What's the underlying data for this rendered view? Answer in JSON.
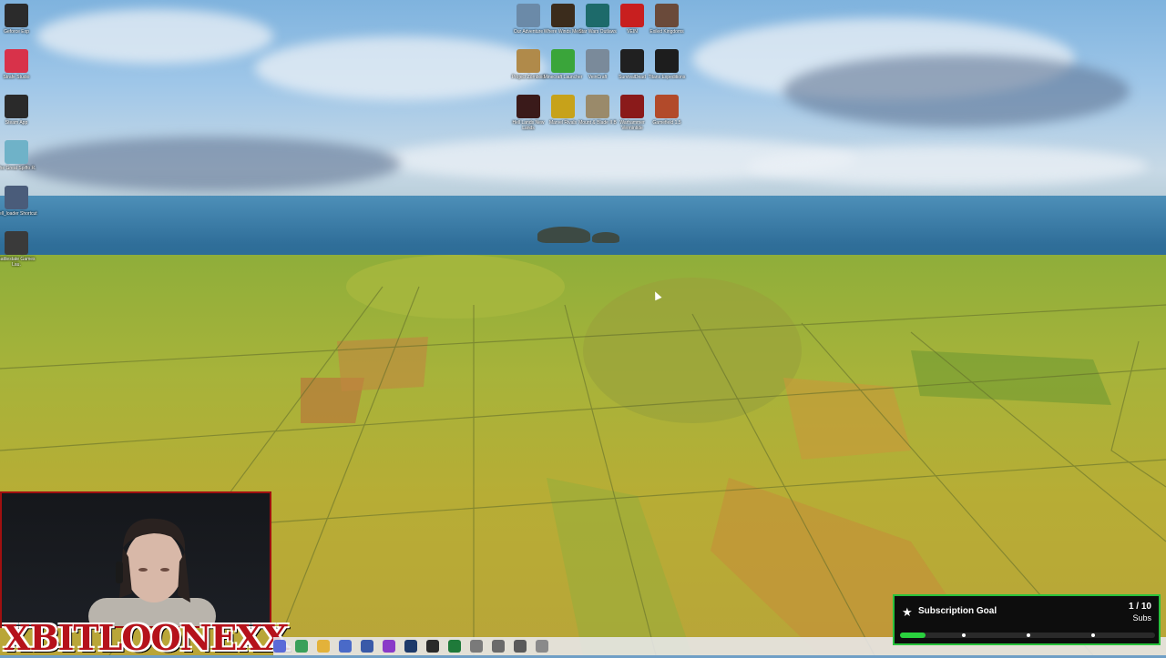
{
  "desktop_left": [
    {
      "label": "Geforce Exp",
      "icon": "geforce-experience-icon",
      "color": "#2b2b2b"
    },
    {
      "label": "Strafe Studio",
      "icon": "red-app-icon",
      "color": "#d8324a"
    },
    {
      "label": "Steam App",
      "icon": "steam-app-icon",
      "color": "#2a2a2a"
    },
    {
      "label": "The Great Spiffo R.",
      "icon": "document-icon",
      "color": "#6fb2c8"
    },
    {
      "label": "Hell_loader Shortcut",
      "icon": "shortcut-icon",
      "color": "#4a5c7a"
    },
    {
      "label": "Battlestate Games Lau.",
      "icon": "battlestate-icon",
      "color": "#3a3a3a"
    }
  ],
  "desktop_grid": [
    {
      "label": "Our Adventure",
      "icon": "game-icon",
      "color": "#6b8aa8"
    },
    {
      "label": "Where Winds Meet",
      "icon": "game-icon",
      "color": "#3b2c1c"
    },
    {
      "label": "Star Wars Outlaws",
      "icon": "game-icon",
      "color": "#1d6a6a"
    },
    {
      "label": "VEIN",
      "icon": "game-icon",
      "color": "#c81f1f"
    },
    {
      "label": "Exiled Kingdoms",
      "icon": "game-icon",
      "color": "#6a4a3a"
    },
    {
      "label": "Project Zomboid",
      "icon": "game-icon",
      "color": "#b08a4a"
    },
    {
      "label": "Minecraft Launcher",
      "icon": "minecraft-icon",
      "color": "#3aa53a"
    },
    {
      "label": "VeinCraft",
      "icon": "game-icon",
      "color": "#7a8a9a"
    },
    {
      "label": "SurvivalDead",
      "icon": "game-icon",
      "color": "#202020"
    },
    {
      "label": "Titans Expeditions",
      "icon": "game-icon",
      "color": "#1d1d1d"
    },
    {
      "label": "Hell Lands New Lands",
      "icon": "game-icon",
      "color": "#3a1a1a"
    },
    {
      "label": "Marvel Rivals",
      "icon": "game-icon",
      "color": "#c7a21a"
    },
    {
      "label": "Mount & Blade II B",
      "icon": "game-icon",
      "color": "#9a8a6a"
    },
    {
      "label": "Warhammer Vermintide",
      "icon": "game-icon",
      "color": "#8a1a1a"
    },
    {
      "label": "Gamefield 1.5",
      "icon": "game-icon",
      "color": "#b24a2a"
    }
  ],
  "streamer": {
    "name": "XBITLOONEXX"
  },
  "subscription_goal": {
    "title": "Subscription Goal",
    "count": "1 / 10",
    "unit": "Subs",
    "progress": 0.1,
    "accent": "#2ad13e"
  },
  "taskbar": {
    "apps": [
      {
        "icon": "app-icon",
        "color": "#5a6ad8"
      },
      {
        "icon": "edge-icon",
        "color": "#3aa05a"
      },
      {
        "icon": "file-explorer-icon",
        "color": "#e3b23a"
      },
      {
        "icon": "app-icon",
        "color": "#4a6ac8"
      },
      {
        "icon": "app-icon",
        "color": "#3a5aa8"
      },
      {
        "icon": "app-icon",
        "color": "#8a3ac8"
      },
      {
        "icon": "steam-icon",
        "color": "#1e3a6a"
      },
      {
        "icon": "app-icon",
        "color": "#2a2a2a"
      },
      {
        "icon": "excel-icon",
        "color": "#1f7a3a"
      },
      {
        "icon": "app-icon",
        "color": "#7a7a7a"
      },
      {
        "icon": "app-icon",
        "color": "#6a6a6a"
      },
      {
        "icon": "settings-icon",
        "color": "#5a5a5a"
      },
      {
        "icon": "app-icon",
        "color": "#8a8a8a"
      }
    ]
  }
}
